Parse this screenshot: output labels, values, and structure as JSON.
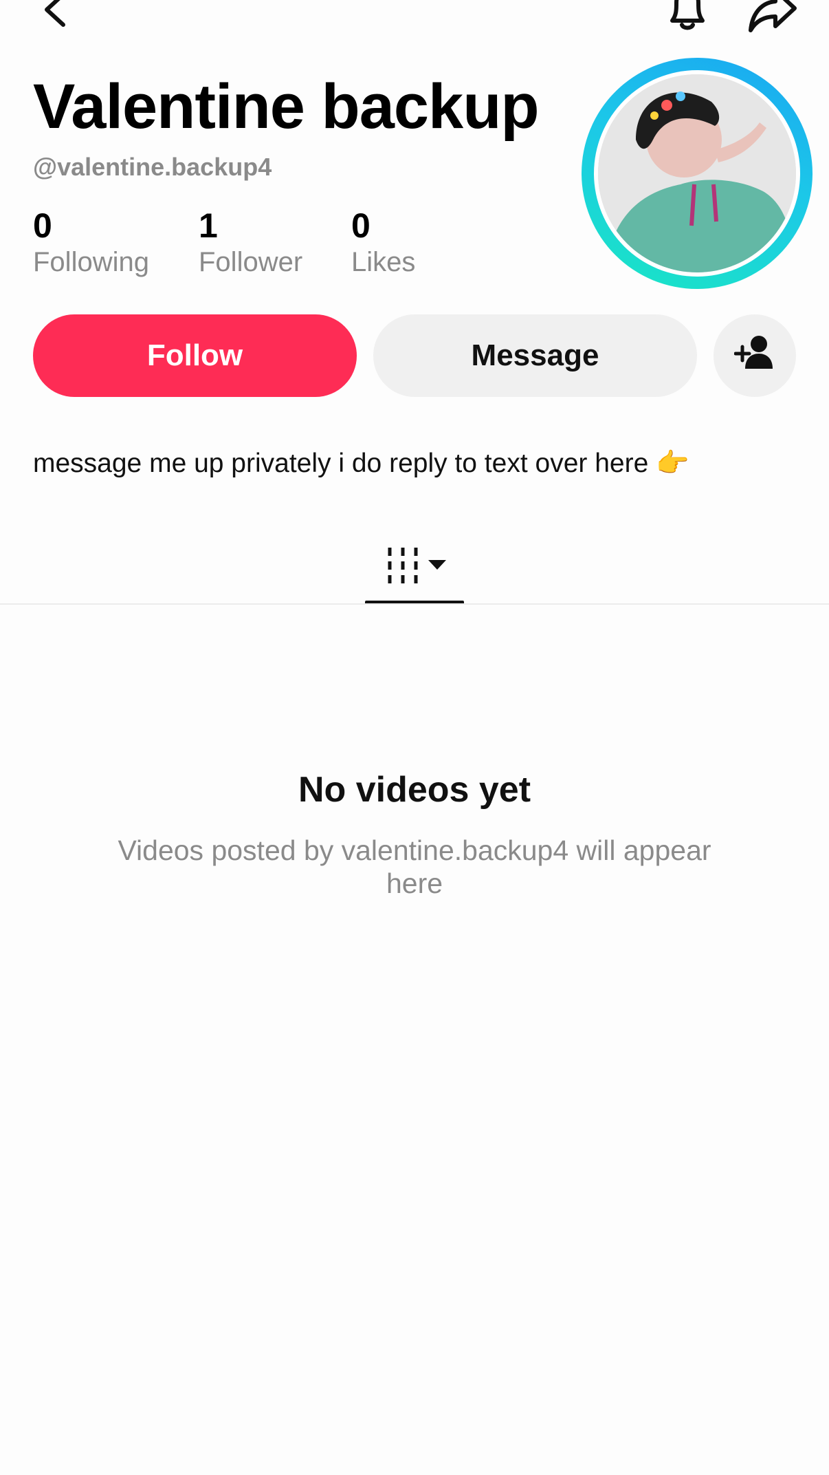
{
  "profile": {
    "display_name": "Valentine backup",
    "handle": "@valentine.backup4",
    "bio": "message me up privately i do reply to text over here 👉",
    "stats": {
      "following_count": "0",
      "following_label": "Following",
      "followers_count": "1",
      "followers_label": "Follower",
      "likes_count": "0",
      "likes_label": "Likes"
    }
  },
  "actions": {
    "follow_label": "Follow",
    "message_label": "Message"
  },
  "icons": {
    "back": "back-chevron-icon",
    "notifications": "bell-icon",
    "share": "share-arrow-icon",
    "add_friend": "add-person-icon",
    "videos_tab": "grid-icon",
    "tab_dropdown": "caret-down-icon"
  },
  "empty_state": {
    "title": "No videos yet",
    "subtitle": "Videos posted by valentine.backup4 will appear here"
  },
  "colors": {
    "accent": "#fe2c55",
    "secondary_button": "#f0f0f0",
    "muted_text": "#8a8a8a",
    "avatar_ring_start": "#1aa6f2",
    "avatar_ring_end": "#1ae6c3"
  }
}
